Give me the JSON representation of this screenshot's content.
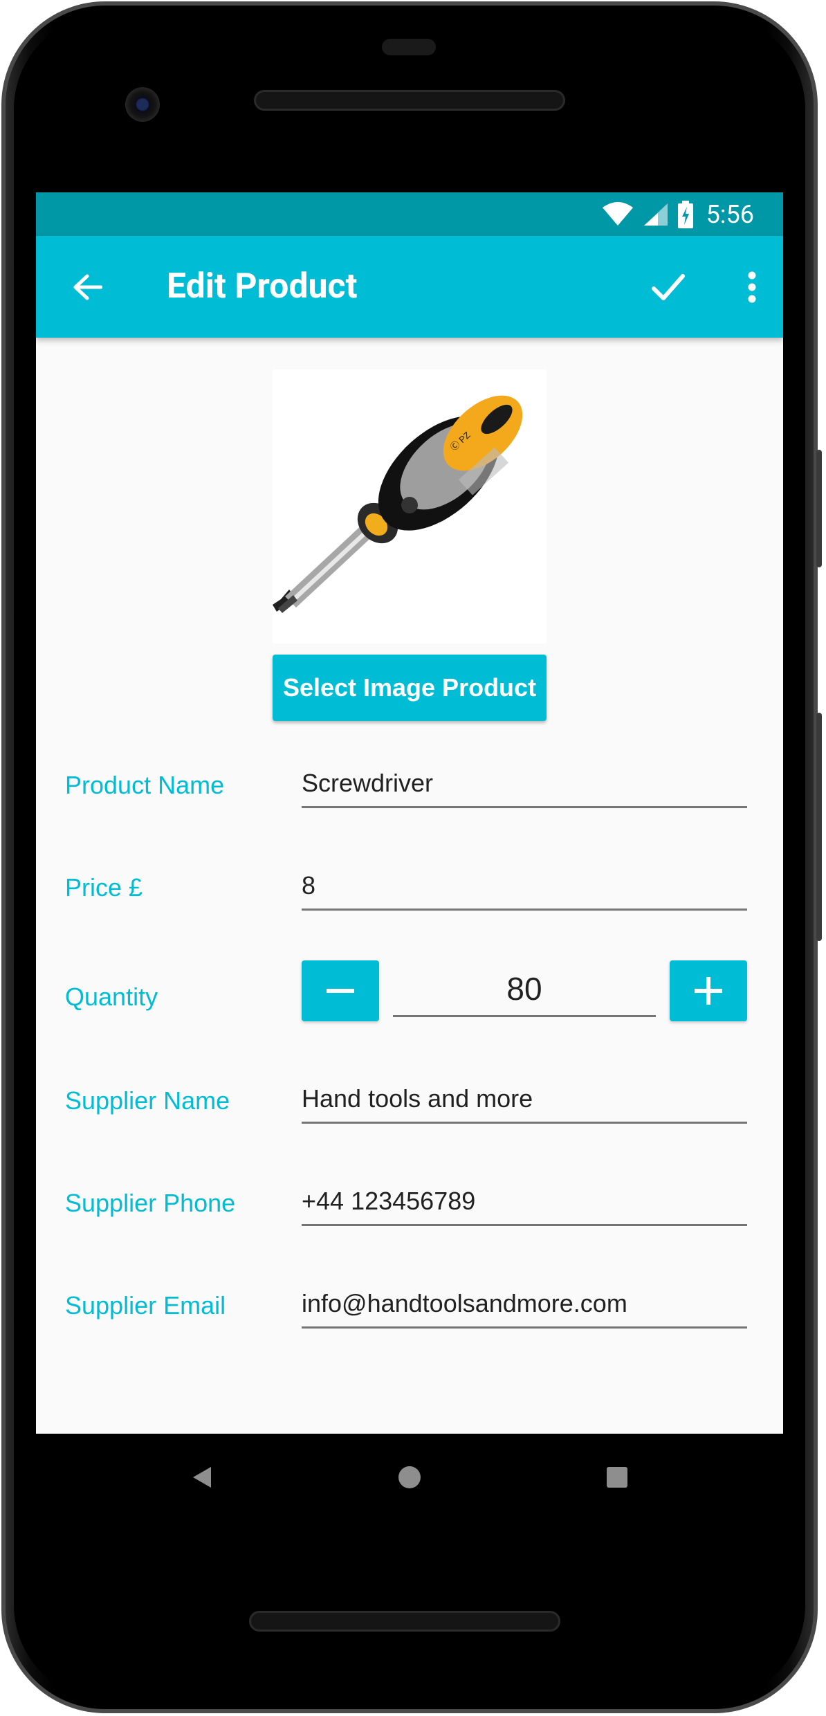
{
  "status_bar": {
    "time": "5:56",
    "icons": [
      "wifi-icon",
      "cell-signal-icon",
      "battery-charging-icon"
    ]
  },
  "app_bar": {
    "title": "Edit Product",
    "back_icon": "arrow-left-icon",
    "save_icon": "checkmark-icon",
    "menu_icon": "more-vertical-icon"
  },
  "product": {
    "image_alt": "screwdriver-photo",
    "select_image_label": "Select Image Product"
  },
  "form": {
    "product_name": {
      "label": "Product Name",
      "value": "Screwdriver"
    },
    "price": {
      "label": "Price £",
      "value": "8"
    },
    "quantity": {
      "label": "Quantity",
      "value": "80",
      "decrement_icon": "minus-icon",
      "increment_icon": "plus-icon"
    },
    "supplier_name": {
      "label": "Supplier Name",
      "value": "Hand tools and more"
    },
    "supplier_phone": {
      "label": "Supplier Phone",
      "value": "+44 123456789"
    },
    "supplier_email": {
      "label": "Supplier Email",
      "value": "info@handtoolsandmore.com"
    }
  },
  "nav_bar": {
    "back": "triangle-back-icon",
    "home": "circle-home-icon",
    "recents": "square-recents-icon"
  },
  "colors": {
    "primary": "#00bcd4",
    "primary_dark": "#0097a7",
    "background": "#fafafa",
    "text": "#212121"
  }
}
